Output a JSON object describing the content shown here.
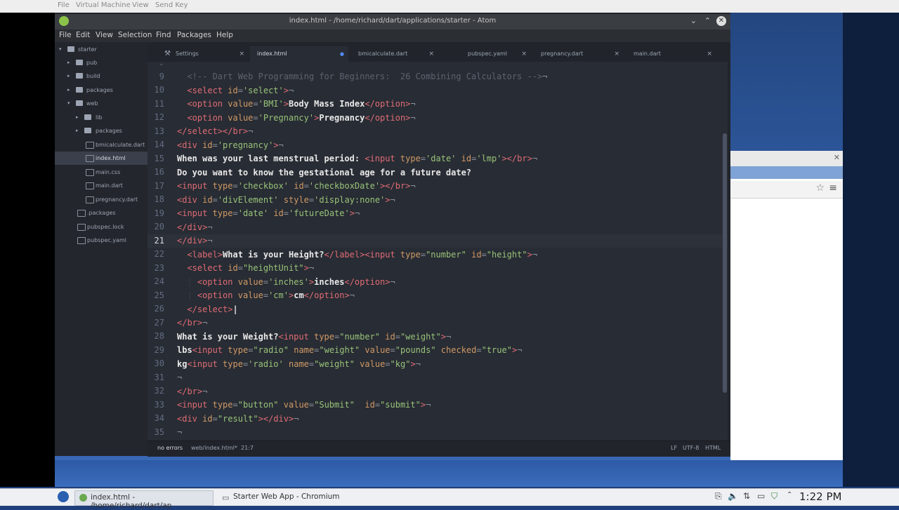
{
  "vm_menu": [
    "File",
    "Virtual Machine",
    "View",
    "Send Key"
  ],
  "atom": {
    "title": "index.html - /home/richard/dart/applications/starter - Atom",
    "menu": [
      "File",
      "Edit",
      "View",
      "Selection",
      "Find",
      "Packages",
      "Help"
    ],
    "tree": {
      "root": "starter",
      "items": [
        {
          "label": "pub",
          "type": "folder"
        },
        {
          "label": "build",
          "type": "folder"
        },
        {
          "label": "packages",
          "type": "folder"
        },
        {
          "label": "web",
          "type": "folder"
        },
        {
          "label": "lib",
          "type": "folder"
        },
        {
          "label": "packages",
          "type": "folder"
        },
        {
          "label": "bmicalculate.dart",
          "type": "file"
        },
        {
          "label": "index.html",
          "type": "file"
        },
        {
          "label": "main.css",
          "type": "file"
        },
        {
          "label": "main.dart",
          "type": "file"
        },
        {
          "label": "pregnancy.dart",
          "type": "file"
        },
        {
          "label": ".packages",
          "type": "file"
        },
        {
          "label": "pubspec.lock",
          "type": "file"
        },
        {
          "label": "pubspec.yaml",
          "type": "file"
        }
      ]
    },
    "tabs": [
      {
        "label": "Settings",
        "close": "×"
      },
      {
        "label": "index.html",
        "close": "●"
      },
      {
        "label": "bmicalculate.dart",
        "close": "×"
      },
      {
        "label": "pubspec.yaml",
        "close": "×"
      },
      {
        "label": "pregnancy.dart",
        "close": "×"
      },
      {
        "label": "main.dart",
        "close": "×"
      }
    ],
    "gutter_fold": "⌄",
    "line_numbers": [
      "9",
      "10",
      "11",
      "12",
      "13",
      "14",
      "15",
      "16",
      "17",
      "18",
      "19",
      "20",
      "21",
      "22",
      "23",
      "24",
      "25",
      "26",
      "27",
      "28",
      "29",
      "30",
      "31",
      "32",
      "33",
      "34",
      "35"
    ],
    "status": {
      "errors": "no errors",
      "path": "web/index.html*",
      "cursor": "21:7",
      "eol": "LF",
      "encoding": "UTF-8",
      "grammar": "HTML"
    }
  },
  "taskbar": {
    "task1": "index.html - /home/richard/dart/ap",
    "task2": "Starter Web App - Chromium",
    "clock": "1:22 PM"
  },
  "colors": {
    "editor_bg": "#282c34",
    "tag": "#e06c75",
    "attr": "#d19a66",
    "string": "#98c379",
    "comment": "#5c6370"
  }
}
